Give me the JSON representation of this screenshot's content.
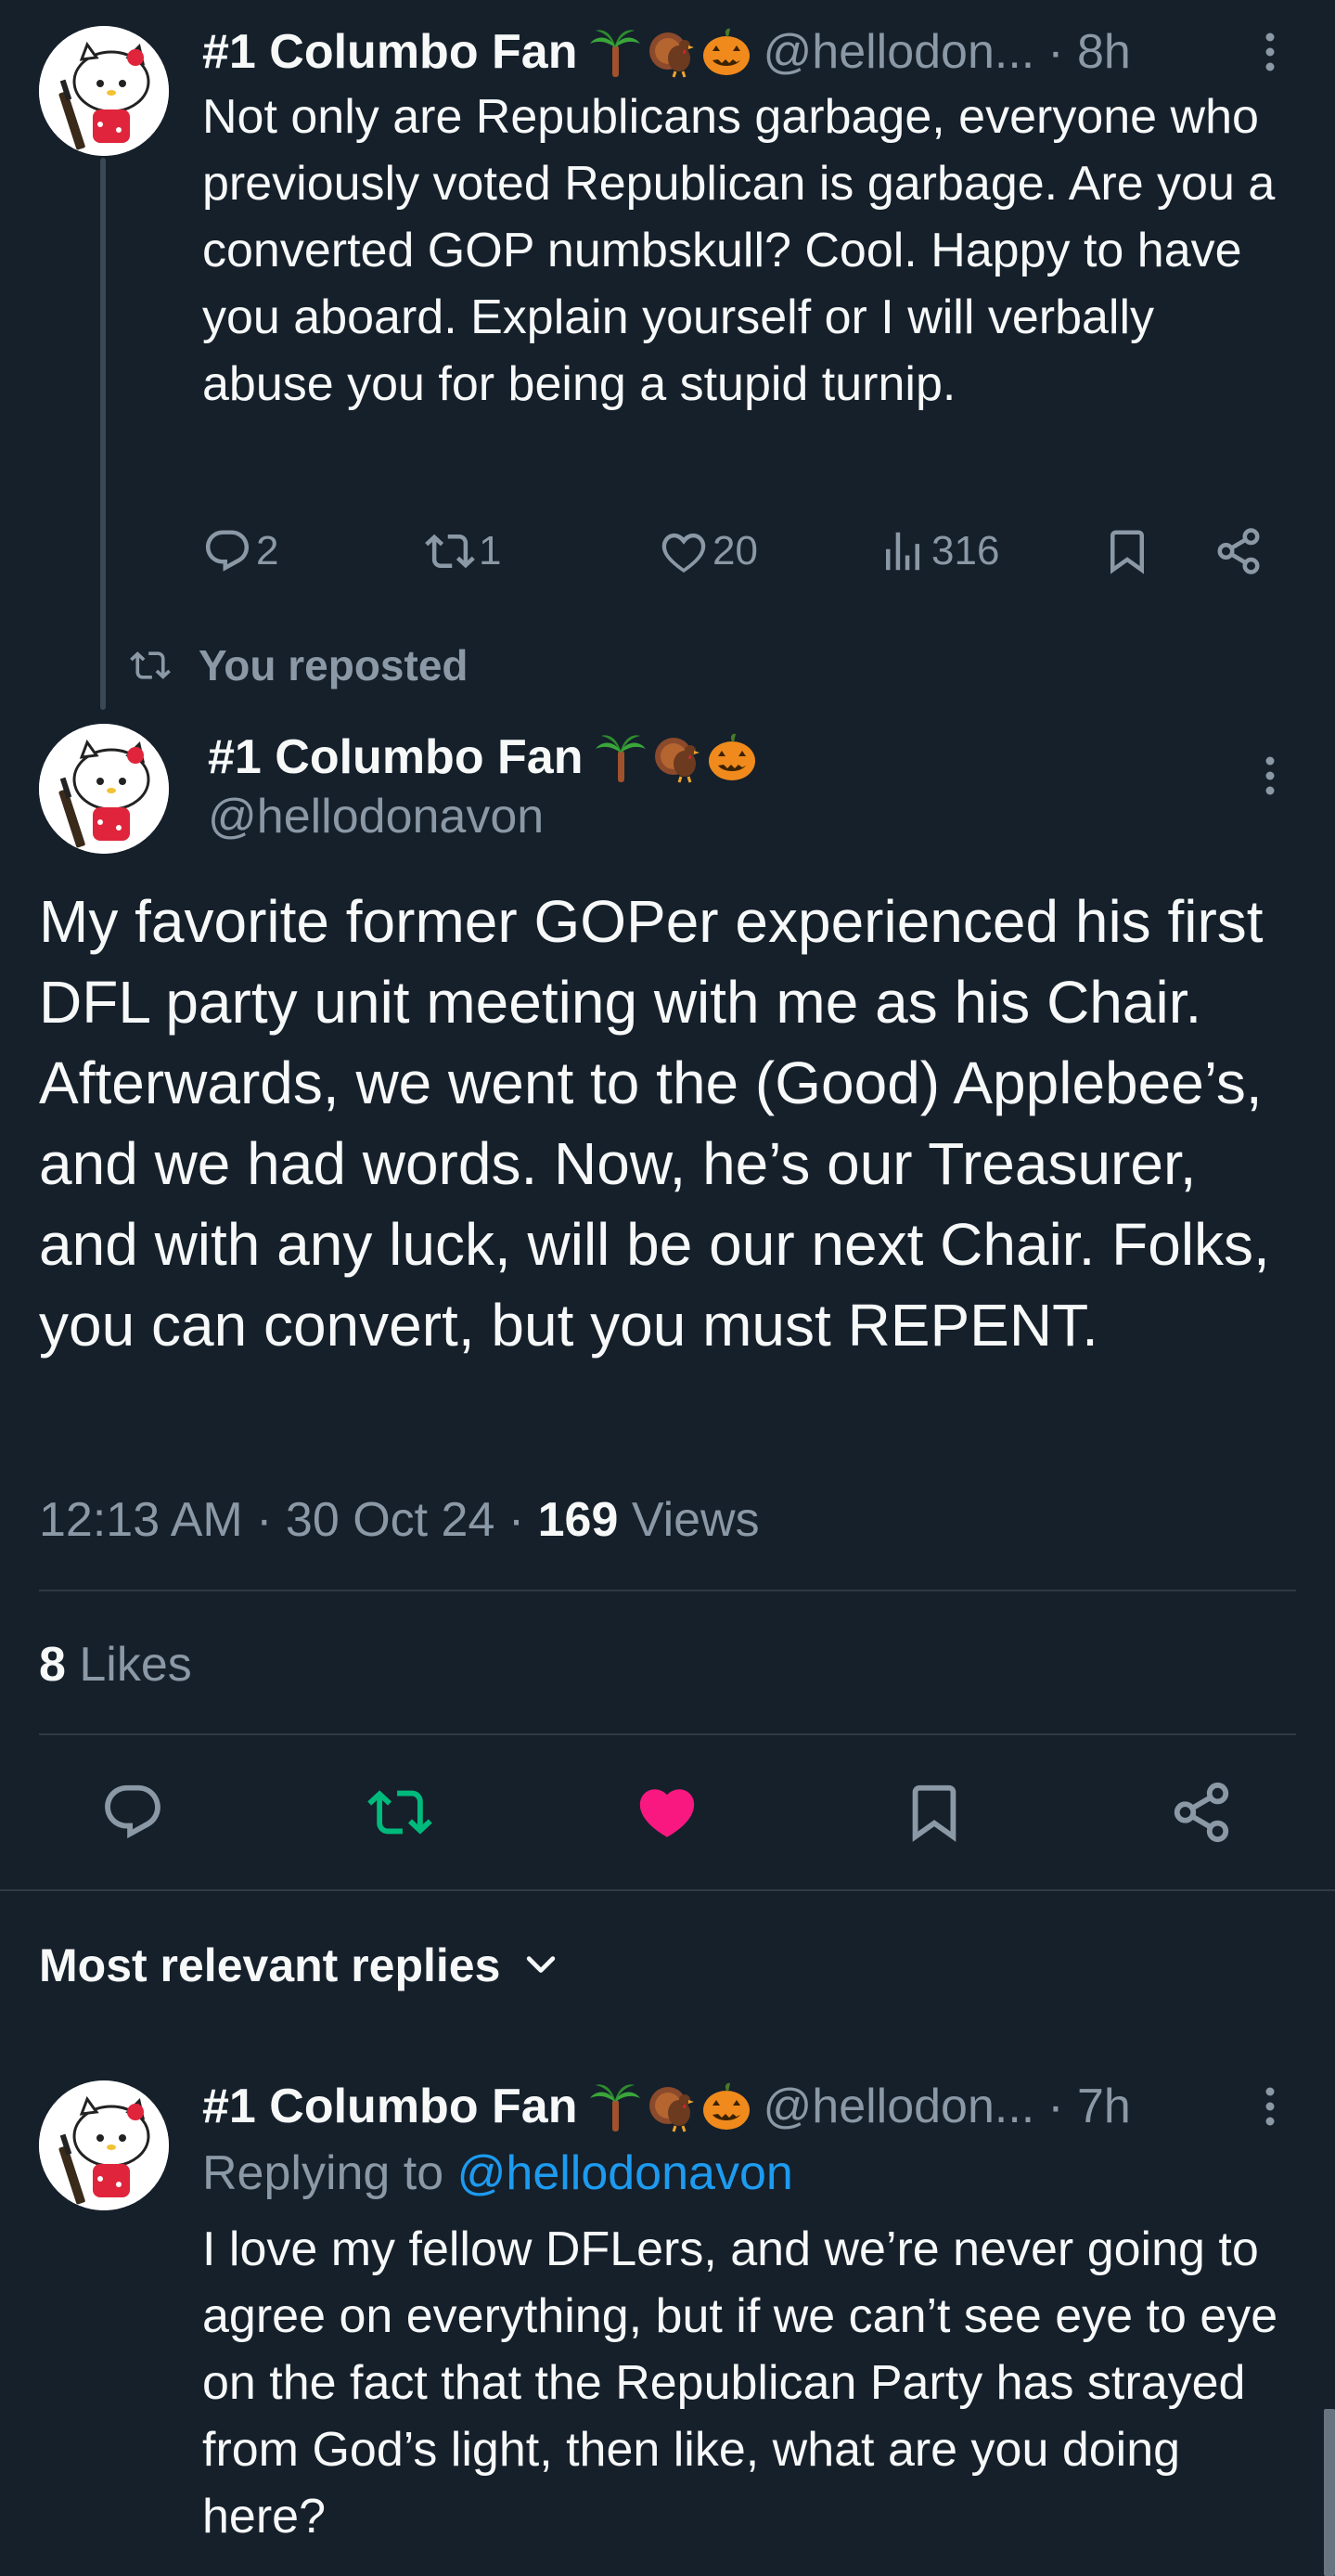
{
  "parent_tweet": {
    "author_name": "#1 Columbo Fan",
    "handle": "@hellodon...",
    "time": "· 8h",
    "text": "Not only are Republicans garbage, everyone who previously voted Republican is garbage. Are you a converted GOP numbskull? Cool. Happy to have you aboard. Explain yourself or I will verbally abuse you for being a stupid turnip.",
    "replies": "2",
    "reposts": "1",
    "likes": "20",
    "views": "316"
  },
  "repost_banner": "You reposted",
  "main_tweet": {
    "author_name": "#1 Columbo Fan",
    "handle": "@hellodonavon",
    "text": "My favorite former GOPer experienced his first DFL party unit meeting with me as his Chair. Afterwards, we went to the (Good) Applebee’s, and we had words. Now, he’s our Treasurer, and with any luck, will be our next Chair. Folks, you can convert, but you must REPENT.",
    "timestamp": "12:13 AM · 30 Oct 24 · ",
    "views_count": "169",
    "views_label": " Views",
    "likes_count": "8",
    "likes_label": " Likes"
  },
  "replies_header": {
    "label": "Most relevant replies"
  },
  "reply_tweet": {
    "author_name": "#1 Columbo Fan",
    "handle": "@hellodon...",
    "time": "· 7h",
    "replying_to_label": "Replying to ",
    "replying_to_handle": "@hellodonavon",
    "text": "I love my fellow DFLers, and we’re never going to agree on everything, but if we can’t see eye to eye on the fact that the Republican Party has strayed from God’s light, then like, what are you doing here?"
  },
  "icons": {
    "emoji_1": "palm-tree-icon",
    "emoji_2": "turkey-icon",
    "emoji_3": "jack-o-lantern-icon"
  },
  "colors": {
    "background": "#15202b",
    "text": "#f7f9f9",
    "muted": "#8b98a5",
    "repost_active": "#00ba7c",
    "like_active": "#f91880",
    "link": "#1d9bf0"
  }
}
